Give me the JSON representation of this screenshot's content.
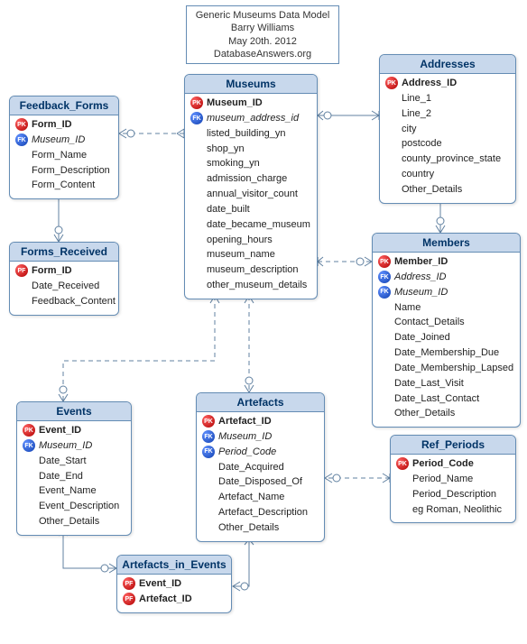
{
  "title_box": {
    "line1": "Generic Museums Data Model",
    "line2": "Barry Williams",
    "line3": "May 20th. 2012",
    "line4": "DatabaseAnswers.org"
  },
  "entities": {
    "feedback_forms": {
      "title": "Feedback_Forms",
      "attrs": [
        {
          "key": "PK",
          "name": "Form_ID",
          "bold": true
        },
        {
          "key": "FK",
          "name": "Museum_ID",
          "italic": true
        },
        {
          "key": "",
          "name": "Form_Name"
        },
        {
          "key": "",
          "name": "Form_Description"
        },
        {
          "key": "",
          "name": "Form_Content"
        }
      ]
    },
    "forms_received": {
      "title": "Forms_Received",
      "attrs": [
        {
          "key": "PF",
          "name": "Form_ID",
          "bold": true
        },
        {
          "key": "",
          "name": "Date_Received"
        },
        {
          "key": "",
          "name": "Feedback_Content"
        }
      ]
    },
    "museums": {
      "title": "Museums",
      "attrs": [
        {
          "key": "PK",
          "name": "Museum_ID",
          "bold": true
        },
        {
          "key": "FK",
          "name": "museum_address_id",
          "italic": true
        },
        {
          "key": "",
          "name": "listed_building_yn"
        },
        {
          "key": "",
          "name": "shop_yn"
        },
        {
          "key": "",
          "name": "smoking_yn"
        },
        {
          "key": "",
          "name": "admission_charge"
        },
        {
          "key": "",
          "name": "annual_visitor_count"
        },
        {
          "key": "",
          "name": "date_built"
        },
        {
          "key": "",
          "name": "date_became_museum"
        },
        {
          "key": "",
          "name": "opening_hours"
        },
        {
          "key": "",
          "name": "museum_name"
        },
        {
          "key": "",
          "name": "museum_description"
        },
        {
          "key": "",
          "name": "other_museum_details"
        }
      ]
    },
    "addresses": {
      "title": "Addresses",
      "attrs": [
        {
          "key": "PK",
          "name": "Address_ID",
          "bold": true
        },
        {
          "key": "",
          "name": "Line_1"
        },
        {
          "key": "",
          "name": "Line_2"
        },
        {
          "key": "",
          "name": "city"
        },
        {
          "key": "",
          "name": "postcode"
        },
        {
          "key": "",
          "name": "county_province_state"
        },
        {
          "key": "",
          "name": "country"
        },
        {
          "key": "",
          "name": "Other_Details"
        }
      ]
    },
    "members": {
      "title": "Members",
      "attrs": [
        {
          "key": "PK",
          "name": "Member_ID",
          "bold": true
        },
        {
          "key": "FK",
          "name": "Address_ID",
          "italic": true
        },
        {
          "key": "FK",
          "name": "Museum_ID",
          "italic": true
        },
        {
          "key": "",
          "name": "Name"
        },
        {
          "key": "",
          "name": "Contact_Details"
        },
        {
          "key": "",
          "name": "Date_Joined"
        },
        {
          "key": "",
          "name": "Date_Membership_Due"
        },
        {
          "key": "",
          "name": "Date_Membership_Lapsed"
        },
        {
          "key": "",
          "name": "Date_Last_Visit"
        },
        {
          "key": "",
          "name": "Date_Last_Contact"
        },
        {
          "key": "",
          "name": "Other_Details"
        }
      ]
    },
    "events": {
      "title": "Events",
      "attrs": [
        {
          "key": "PK",
          "name": "Event_ID",
          "bold": true
        },
        {
          "key": "FK",
          "name": "Museum_ID",
          "italic": true
        },
        {
          "key": "",
          "name": "Date_Start"
        },
        {
          "key": "",
          "name": "Date_End"
        },
        {
          "key": "",
          "name": "Event_Name"
        },
        {
          "key": "",
          "name": "Event_Description"
        },
        {
          "key": "",
          "name": "Other_Details"
        }
      ]
    },
    "artefacts": {
      "title": "Artefacts",
      "attrs": [
        {
          "key": "PK",
          "name": "Artefact_ID",
          "bold": true
        },
        {
          "key": "FK",
          "name": "Museum_ID",
          "italic": true
        },
        {
          "key": "FK",
          "name": "Period_Code",
          "italic": true
        },
        {
          "key": "",
          "name": "Date_Acquired"
        },
        {
          "key": "",
          "name": "Date_Disposed_Of"
        },
        {
          "key": "",
          "name": "Artefact_Name"
        },
        {
          "key": "",
          "name": "Artefact_Description"
        },
        {
          "key": "",
          "name": "Other_Details"
        }
      ]
    },
    "ref_periods": {
      "title": "Ref_Periods",
      "attrs": [
        {
          "key": "PK",
          "name": "Period_Code",
          "bold": true
        },
        {
          "key": "",
          "name": "Period_Name"
        },
        {
          "key": "",
          "name": "Period_Description"
        },
        {
          "key": "",
          "name": "eg Roman, Neolithic"
        }
      ]
    },
    "artefacts_in_events": {
      "title": "Artefacts_in_Events",
      "attrs": [
        {
          "key": "PF",
          "name": "Event_ID",
          "bold": true
        },
        {
          "key": "PF",
          "name": "Artefact_ID",
          "bold": true
        }
      ]
    }
  }
}
